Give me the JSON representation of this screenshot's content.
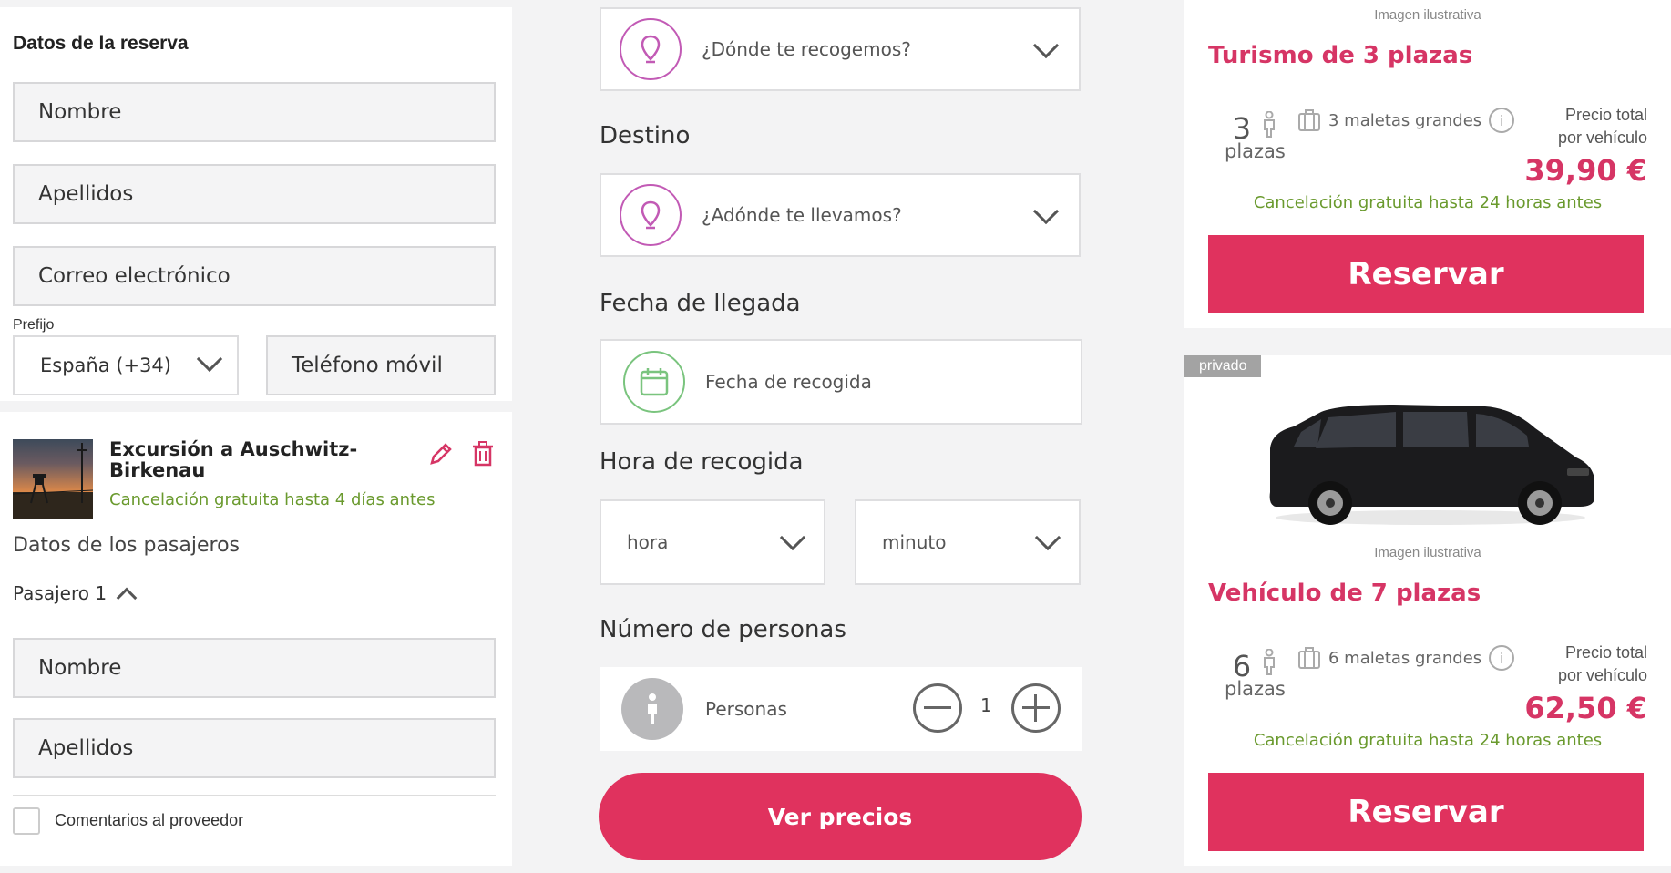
{
  "booking": {
    "title": "Datos de la reserva",
    "name_placeholder": "Nombre",
    "surname_placeholder": "Apellidos",
    "email_placeholder": "Correo electrónico",
    "prefix_label": "Prefijo",
    "prefix_value": "España (+34)",
    "phone_placeholder": "Teléfono móvil"
  },
  "excursion": {
    "title": "Excursión a Auschwitz-Birkenau",
    "cancellation": "Cancelación gratuita hasta 4 días antes",
    "passengers_heading": "Datos de los pasajeros",
    "passenger_label": "Pasajero 1",
    "name_placeholder": "Nombre",
    "surname_placeholder": "Apellidos",
    "comments_label": "Comentarios al proveedor"
  },
  "search": {
    "pickup_placeholder": "¿Dónde te recogemos?",
    "destination_label": "Destino",
    "destination_placeholder": "¿Adónde te llevamos?",
    "arrival_date_label": "Fecha de llegada",
    "pickup_date_placeholder": "Fecha de recogida",
    "pickup_time_label": "Hora de recogida",
    "hour_placeholder": "hora",
    "minute_placeholder": "minuto",
    "people_label": "Número de personas",
    "people_field": "Personas",
    "people_count": "1",
    "submit_label": "Ver precios"
  },
  "vehicles": [
    {
      "caption": "Imagen ilustrativa",
      "title": "Turismo de 3 plazas",
      "seats": "3",
      "seats_label": "plazas",
      "luggage": "3 maletas grandes",
      "price_label_1": "Precio total",
      "price_label_2": "por vehículo",
      "price": "39,90 €",
      "cancellation": "Cancelación gratuita hasta 24 horas antes",
      "button": "Reservar"
    },
    {
      "tag": "privado",
      "caption": "Imagen ilustrativa",
      "title": "Vehículo de 7 plazas",
      "seats": "6",
      "seats_label": "plazas",
      "luggage": "6 maletas grandes",
      "price_label_1": "Precio total",
      "price_label_2": "por vehículo",
      "price": "62,50 €",
      "cancellation": "Cancelación gratuita hasta 24 horas antes",
      "button": "Reservar"
    }
  ],
  "colors": {
    "accent": "#e0325e",
    "price": "#d63565",
    "success": "#6a9a2e",
    "pin": "#c25ab5",
    "calendar": "#7ac47e"
  }
}
